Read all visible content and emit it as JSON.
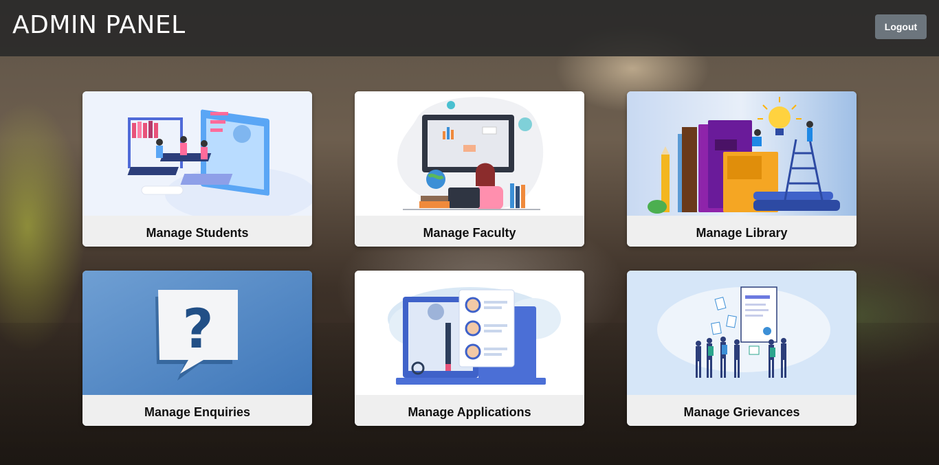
{
  "header": {
    "title": "ADMIN PANEL",
    "logout_label": "Logout"
  },
  "cards": [
    {
      "label": "Manage Students",
      "icon": "classroom-illustration"
    },
    {
      "label": "Manage Faculty",
      "icon": "teacher-laptop-illustration"
    },
    {
      "label": "Manage Library",
      "icon": "books-lightbulb-illustration"
    },
    {
      "label": "Manage Enquiries",
      "icon": "question-mark-illustration"
    },
    {
      "label": "Manage Applications",
      "icon": "profiles-laptop-illustration"
    },
    {
      "label": "Manage Grievances",
      "icon": "people-document-illustration"
    }
  ],
  "colors": {
    "topbar": "#282828",
    "logout_button": "#6c757d",
    "card_label_bg": "#efefef"
  }
}
